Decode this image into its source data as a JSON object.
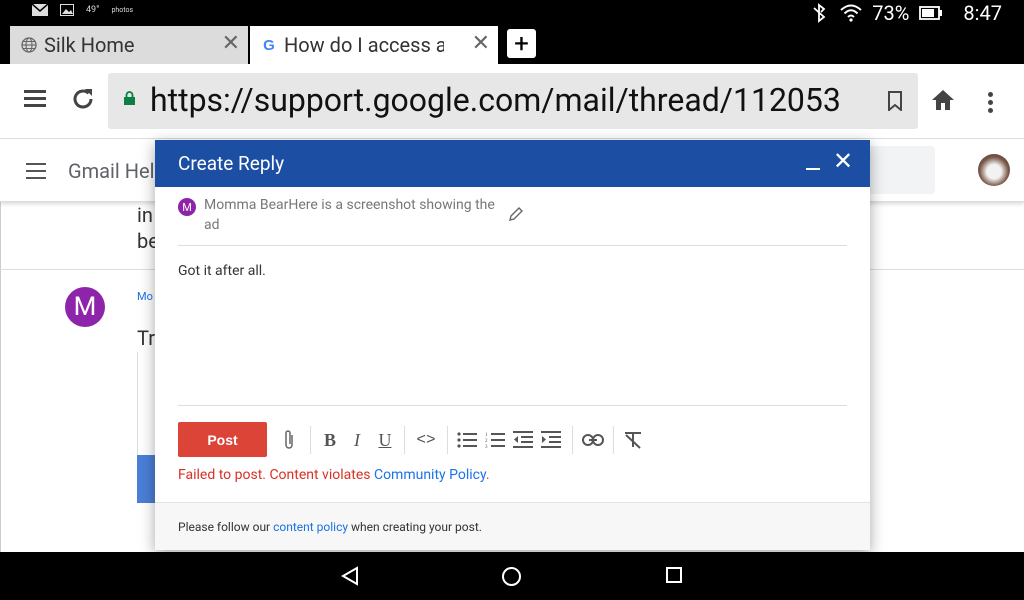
{
  "status_bar": {
    "left_icons": [
      "mail-icon",
      "photo-icon",
      "weather-icon",
      "photos-app-icon"
    ],
    "temperature": "49°",
    "photos_label": "photos",
    "battery_percent": "73%",
    "time": "8:47"
  },
  "tabs": [
    {
      "label": "Silk Home",
      "icon": "globe-icon",
      "active": false
    },
    {
      "label": "How do I access ar",
      "icon": "google-icon",
      "active": true
    }
  ],
  "toolbar": {
    "url": "https://support.google.com/mail/thread/112053"
  },
  "page": {
    "header_title": "Gmail Hel",
    "bg_line1": "in",
    "bg_line2": "be",
    "bg_avatar_letter": "M",
    "bg_author": "Mo",
    "bg_heading": "Tr"
  },
  "dialog": {
    "title": "Create Reply",
    "quote_avatar_letter": "M",
    "quote_text": "Momma BearHere is a screenshot showing the ad",
    "body_text": "Got it after all.",
    "post_label": "Post",
    "error_prefix": "Failed to post. Content violates ",
    "error_link": "Community Policy",
    "error_suffix": ".",
    "footer_prefix": "Please follow our ",
    "footer_link": "content policy",
    "footer_suffix": " when creating your post.",
    "format_tools": [
      "attach-icon",
      "bold-icon",
      "italic-icon",
      "underline-icon",
      "code-icon",
      "bulleted-list-icon",
      "numbered-list-icon",
      "outdent-icon",
      "indent-icon",
      "link-icon",
      "clear-format-icon"
    ]
  },
  "colors": {
    "dialog_header": "#1c4ea3",
    "post_button": "#db4437",
    "error": "#d93025",
    "link": "#1a73e8",
    "avatar": "#8e24aa"
  }
}
